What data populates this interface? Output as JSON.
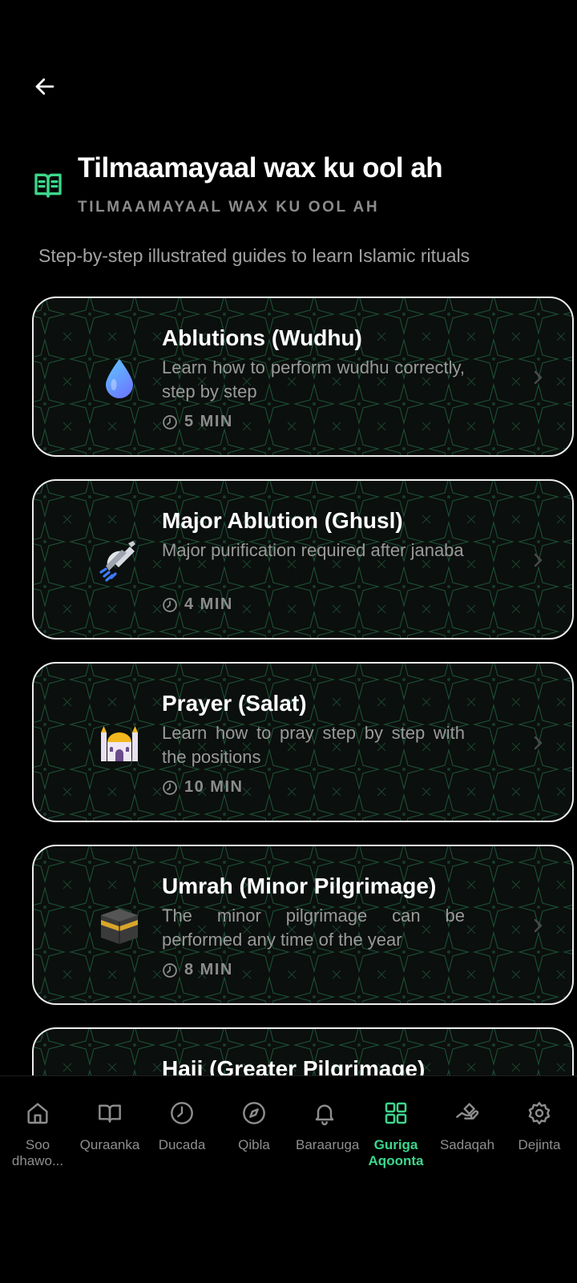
{
  "header": {
    "title": "Tilmaamayaal wax ku ool ah",
    "subtitle": "TILMAAMAYAAL WAX KU OOL AH",
    "description": "Step-by-step illustrated guides to learn Islamic rituals"
  },
  "colors": {
    "accent": "#3dd68c",
    "card_border": "#ededed",
    "pattern": "#1f5a3c"
  },
  "guides": [
    {
      "title": "Ablutions (Wudhu)",
      "description": "Learn how to perform wudhu correctly, step by step",
      "duration": "5 MIN",
      "icon": "water-drop-icon"
    },
    {
      "title": "Major Ablution (Ghusl)",
      "description": "Major purification required after janaba",
      "duration": "4 MIN",
      "icon": "shower-icon"
    },
    {
      "title": "Prayer (Salat)",
      "description": "Learn how to pray step by step with the positions",
      "duration": "10 MIN",
      "icon": "mosque-icon"
    },
    {
      "title": "Umrah (Minor Pilgrimage)",
      "description": "The minor pilgrimage can be performed any time of the year",
      "duration": "8 MIN",
      "icon": "kaaba-icon"
    },
    {
      "title": "Hajj (Greater Pilgrimage)",
      "description": "",
      "duration": "",
      "icon": ""
    }
  ],
  "nav": {
    "items": [
      {
        "label": "Soo dhawo...",
        "icon": "home-icon"
      },
      {
        "label": "Quraanka",
        "icon": "book-icon"
      },
      {
        "label": "Ducada",
        "icon": "clock-icon"
      },
      {
        "label": "Qibla",
        "icon": "compass-icon"
      },
      {
        "label": "Baraaruga",
        "icon": "bell-icon"
      },
      {
        "label": "Guriga Aqoonta",
        "icon": "grid-icon",
        "active": true
      },
      {
        "label": "Sadaqah",
        "icon": "charity-hand-icon"
      },
      {
        "label": "Dejinta",
        "icon": "gear-icon"
      }
    ]
  }
}
